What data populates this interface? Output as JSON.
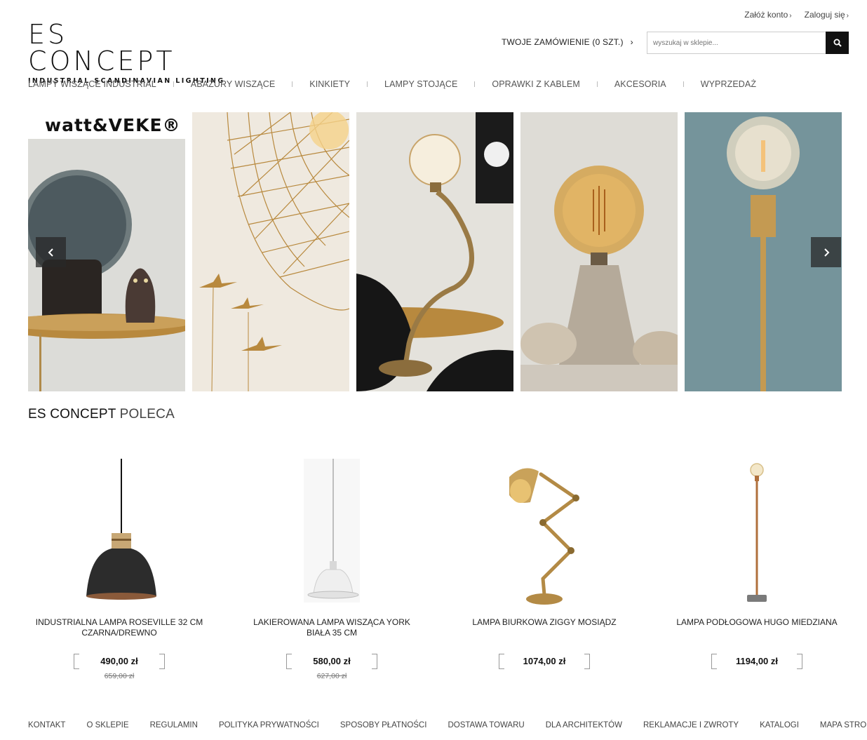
{
  "account": {
    "register": "Załóż konto",
    "login": "Zaloguj się"
  },
  "logo": {
    "main": "ES CONCEPT",
    "tagline": "INDUSTRIAL SCANDINAVIAN LIGHTING"
  },
  "order": {
    "label": "TWOJE ZAMÓWIENIE (0 SZT.)"
  },
  "search": {
    "placeholder": "wyszukaj w sklepie..."
  },
  "nav": [
    "LAMPY WISZĄCE INDUSTRIAL",
    "ABAŻURY WISZĄCE",
    "KINKIETY",
    "LAMPY STOJĄCE",
    "OPRAWKI Z KABLEM",
    "AKCESORIA",
    "WYPRZEDAŻ"
  ],
  "slider": {
    "brand": "watt&VEKE®"
  },
  "section": {
    "title_bold": "ES CONCEPT",
    "title_light": "POLECA"
  },
  "products": [
    {
      "name": "INDUSTRIALNA LAMPA ROSEVILLE 32 CM CZARNA/DREWNO",
      "price": "490,00 zł",
      "old_price": "659,00 zł"
    },
    {
      "name": "LAKIEROWANA LAMPA WISZĄCA YORK BIAŁA 35 CM",
      "price": "580,00 zł",
      "old_price": "627,00 zł"
    },
    {
      "name": "LAMPA BIURKOWA ZIGGY MOSIĄDZ",
      "price": "1074,00 zł",
      "old_price": ""
    },
    {
      "name": "LAMPA PODŁOGOWA HUGO MIEDZIANA",
      "price": "1194,00 zł",
      "old_price": ""
    }
  ],
  "footer": [
    "KONTAKT",
    "O SKLEPIE",
    "REGULAMIN",
    "POLITYKA PRYWATNOŚCI",
    "SPOSOBY PŁATNOŚCI",
    "DOSTAWA TOWARU",
    "DLA ARCHITEKTÓW",
    "REKLAMACJE I ZWROTY",
    "KATALOGI",
    "MAPA STRONY"
  ],
  "colors": {
    "text": "#222222",
    "accent": "#111111",
    "brass": "#b8893e"
  }
}
